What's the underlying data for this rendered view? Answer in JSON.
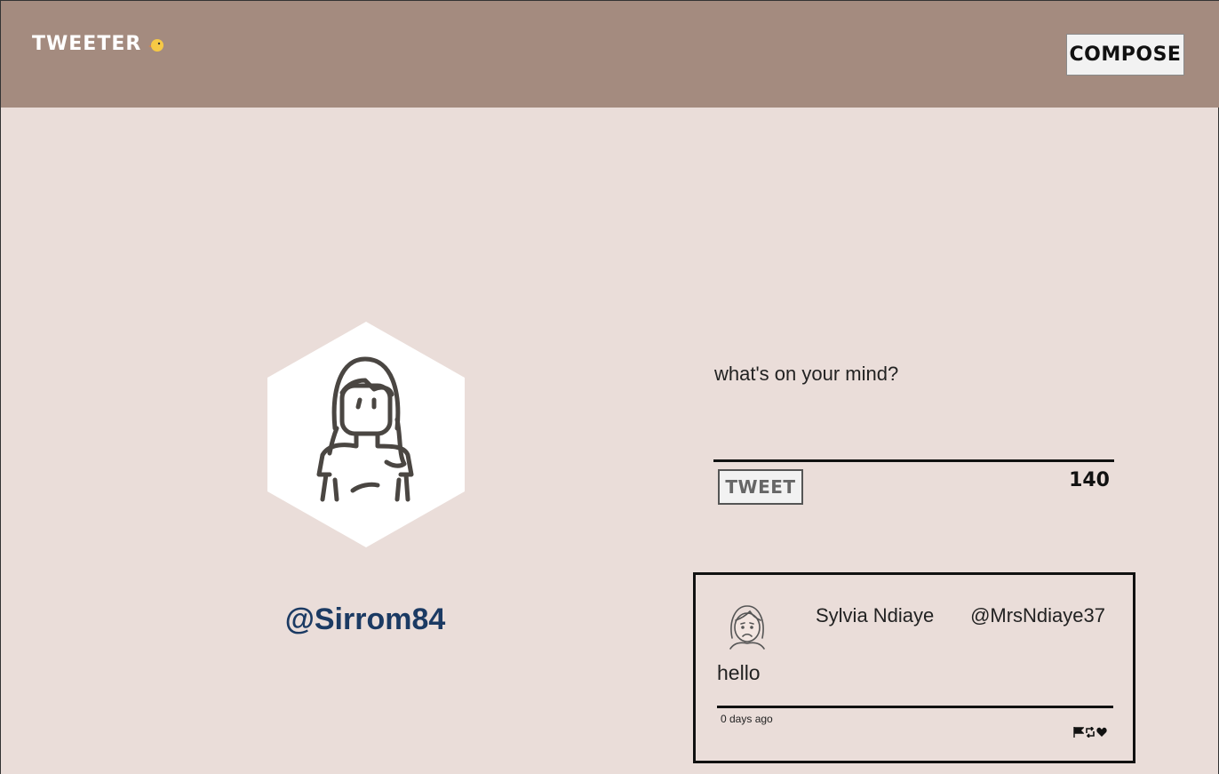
{
  "nav": {
    "brand": "TWEETER",
    "brand_icon": "chick-icon",
    "compose_label": "COMPOSE"
  },
  "profile": {
    "avatar_icon": "woman-avatar-icon",
    "handle": "@Sirrom84"
  },
  "composer": {
    "placeholder": "what's on your mind?",
    "value": "",
    "tweet_label": "TWEET",
    "counter": "140"
  },
  "tweets": [
    {
      "avatar_icon": "frowning-woman-avatar-icon",
      "name": "Sylvia Ndiaye",
      "handle": "@MrsNdiaye37",
      "content": "hello",
      "time": "0 days ago",
      "actions": [
        "flag-icon",
        "retweet-icon",
        "heart-icon"
      ]
    }
  ],
  "colors": {
    "nav_bg": "#a48b7f",
    "page_bg": "#eaddd9",
    "handle_color": "#1b3a63"
  }
}
